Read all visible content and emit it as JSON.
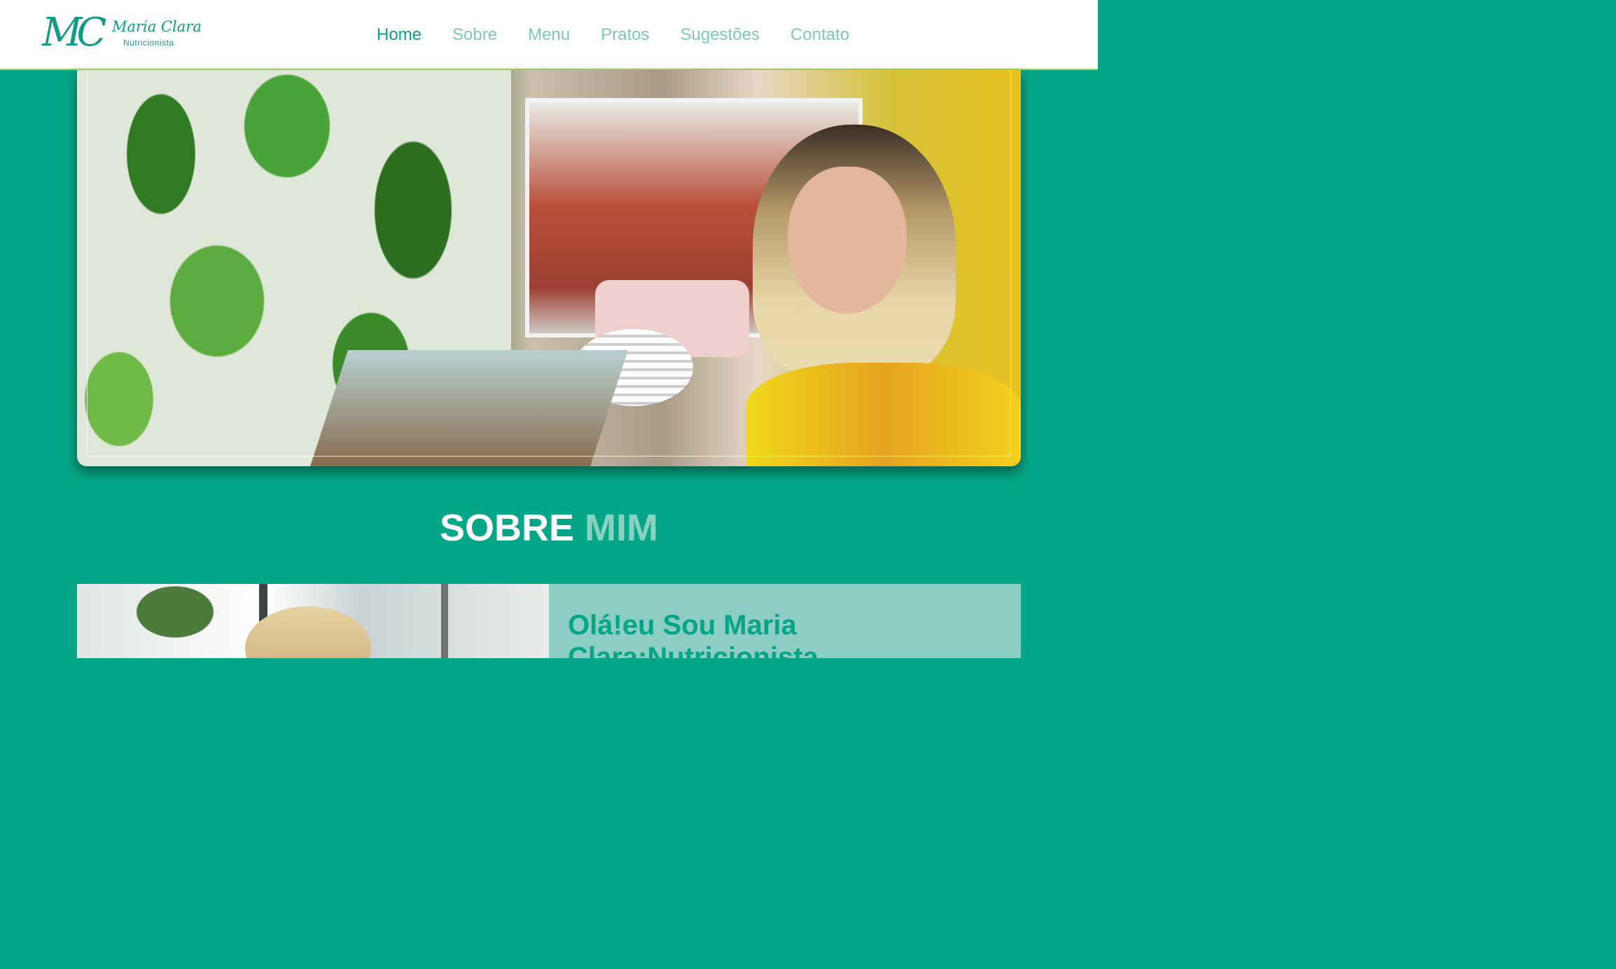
{
  "brand": {
    "monogram": "MC",
    "name": "Maria Clara",
    "role": "Nutricionista",
    "color": "#129b84"
  },
  "nav": {
    "items": [
      {
        "label": "Home",
        "active": true
      },
      {
        "label": "Sobre",
        "active": false
      },
      {
        "label": "Menu",
        "active": false
      },
      {
        "label": "Pratos",
        "active": false
      },
      {
        "label": "Sugestões",
        "active": false
      },
      {
        "label": "Contato",
        "active": false
      }
    ]
  },
  "hero": {
    "image": "office-photo-with-nutritionist"
  },
  "about": {
    "title_part1": "SOBRE",
    "title_part2": "MIM",
    "heading": "Olá!eu Sou Maria Clara:Nutricionista"
  },
  "colors": {
    "background": "#05a687",
    "accent_light": "#8ad1c3",
    "nav_inactive": "#7cc9b7",
    "nav_active": "#0f9b84",
    "header_border": "#a9d56b"
  }
}
